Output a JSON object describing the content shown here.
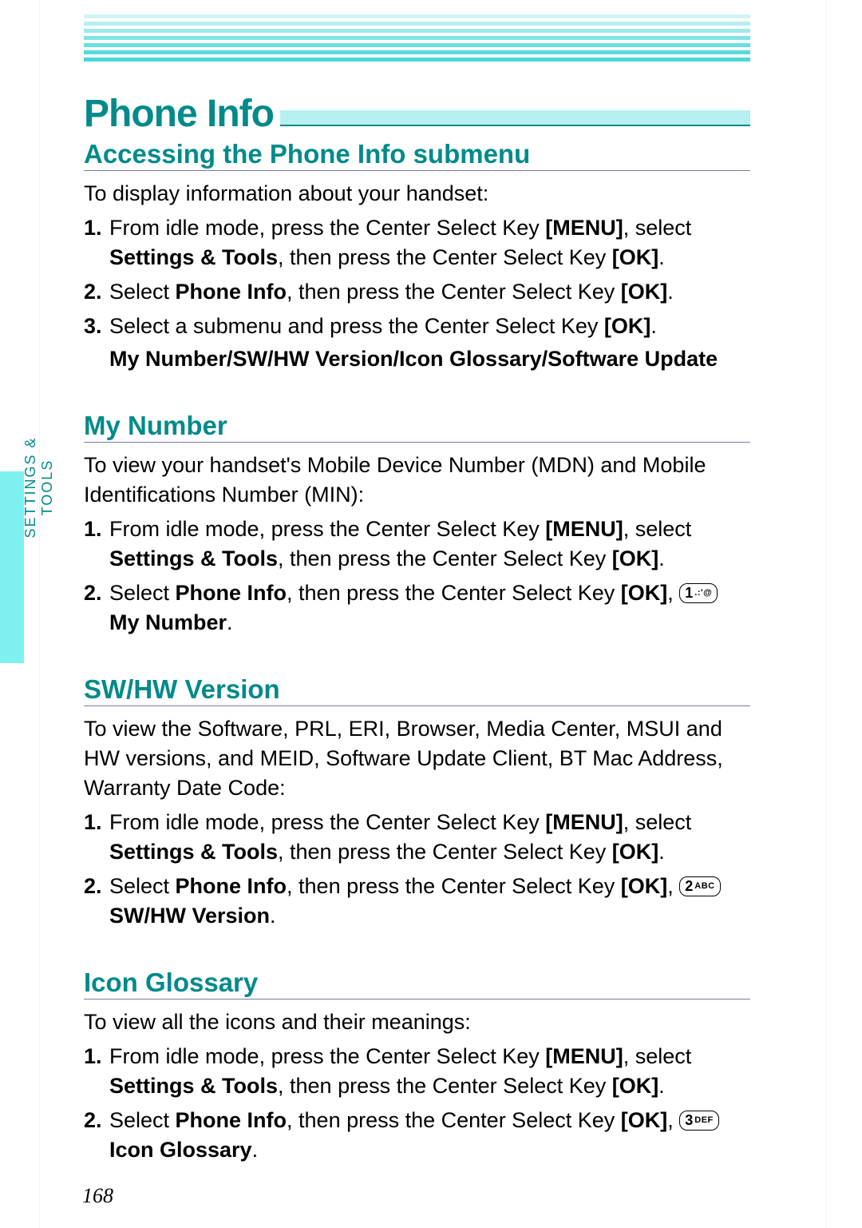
{
  "sideTab": "SETTINGS & TOOLS",
  "pageNumber": "168",
  "mainTitle": "Phone Info",
  "sections": [
    {
      "heading": "Accessing the Phone Info submenu",
      "intro": "To display information about your handset:",
      "steps": [
        {
          "prefix": "From idle mode, press the Center Select Key ",
          "b1": "[MENU]",
          "mid1": ", select ",
          "b2": "Settings & Tools",
          "mid2": ", then press the Center Select Key ",
          "b3": "[OK]",
          "post": "."
        },
        {
          "prefix": "Select ",
          "b1": "Phone Info",
          "mid1": ", then press the Center Select Key ",
          "b2": "[OK]",
          "post": "."
        },
        {
          "prefix": "Select a submenu and press the Center Select Key ",
          "b1": "[OK]",
          "post": "."
        }
      ],
      "submenuLine": "My Number/SW/HW Version/Icon Glossary/Software Update"
    },
    {
      "heading": "My Number",
      "intro": "To view your handset's Mobile Device Number (MDN) and Mobile Identifications Number (MIN):",
      "steps": [
        {
          "prefix": "From idle mode, press the Center Select Key ",
          "b1": "[MENU]",
          "mid1": ", select ",
          "b2": "Settings & Tools",
          "mid2": ", then press the Center Select Key ",
          "b3": "[OK]",
          "post": "."
        },
        {
          "prefix": "Select ",
          "b1": "Phone Info",
          "mid1": ", then press the Center Select Key ",
          "b2": "[OK]",
          "mid2": ", ",
          "keyNum": "1",
          "keySup": ".:'@",
          "b3": "My Number",
          "post": "."
        }
      ]
    },
    {
      "heading": "SW/HW Version",
      "intro": "To view the Software, PRL, ERI, Browser, Media Center, MSUI and HW versions, and MEID, Software Update Client, BT Mac Address, Warranty Date Code:",
      "steps": [
        {
          "prefix": "From idle mode, press the Center Select Key ",
          "b1": "[MENU]",
          "mid1": ", select ",
          "b2": "Settings & Tools",
          "mid2": ", then press the Center Select Key ",
          "b3": "[OK]",
          "post": "."
        },
        {
          "prefix": "Select ",
          "b1": "Phone Info",
          "mid1": ", then press the Center Select Key ",
          "b2": "[OK]",
          "mid2": ", ",
          "keyNum": "2",
          "keySup": "ABC",
          "b3": "SW/HW Version",
          "post": "."
        }
      ]
    },
    {
      "heading": "Icon Glossary",
      "intro": "To view all the icons and their meanings:",
      "steps": [
        {
          "prefix": "From idle mode, press the Center Select Key ",
          "b1": "[MENU]",
          "mid1": ", select ",
          "b2": "Settings & Tools",
          "mid2": ", then press the Center Select Key ",
          "b3": "[OK]",
          "post": "."
        },
        {
          "prefix": "Select ",
          "b1": "Phone Info",
          "mid1": ", then press the Center Select Key ",
          "b2": "[OK]",
          "mid2": ", ",
          "keyNum": "3",
          "keySup": "DEF",
          "b3": "Icon Glossary",
          "post": "."
        }
      ]
    }
  ]
}
